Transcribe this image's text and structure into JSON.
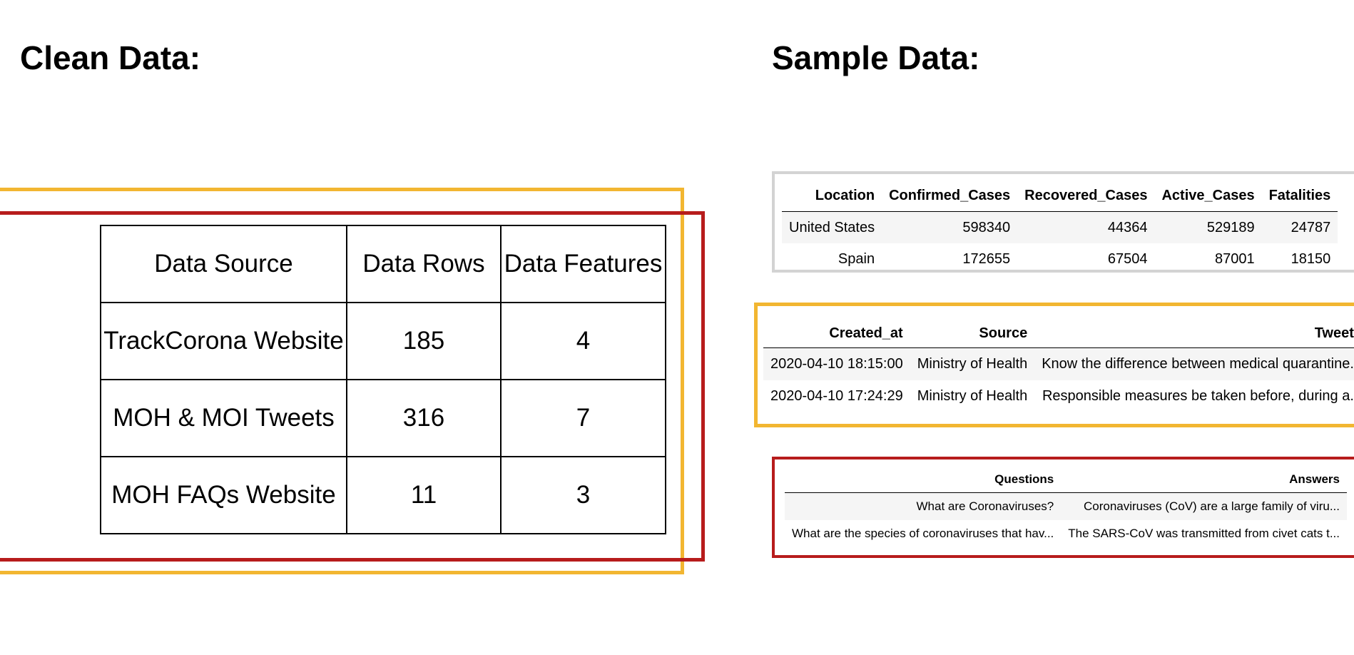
{
  "clean": {
    "title": "Clean Data:",
    "table": {
      "headers": [
        "Data Source",
        "Data Rows",
        "Data Features"
      ],
      "rows": [
        [
          "TrackCorona Website",
          "185",
          "4"
        ],
        [
          "MOH & MOI Tweets",
          "316",
          "7"
        ],
        [
          "MOH FAQs Website",
          "11",
          "3"
        ]
      ]
    }
  },
  "sample": {
    "title": "Sample Data:",
    "cases": {
      "headers": [
        "Location",
        "Confirmed_Cases",
        "Recovered_Cases",
        "Active_Cases",
        "Fatalities"
      ],
      "rows": [
        [
          "United States",
          "598340",
          "44364",
          "529189",
          "24787"
        ],
        [
          "Spain",
          "172655",
          "67504",
          "87001",
          "18150"
        ]
      ]
    },
    "tweets": {
      "headers": [
        "Created_at",
        "Source",
        "Tweets"
      ],
      "rows": [
        [
          "2020-04-10 18:15:00",
          "Ministry of Health",
          "Know the difference between medical quarantine..."
        ],
        [
          "2020-04-10 17:24:29",
          "Ministry of Health",
          "Responsible measures be taken before, during a..."
        ]
      ]
    },
    "faqs": {
      "headers": [
        "Questions",
        "Answers"
      ],
      "rows": [
        [
          "What are Coronaviruses?",
          "Coronaviruses (CoV) are a large family of viru..."
        ],
        [
          "What are the species of coronaviruses that hav...",
          "The SARS-CoV was transmitted from civet cats t..."
        ]
      ]
    }
  },
  "colors": {
    "yellow_frame": "#f2b631",
    "red_frame": "#b71c1c",
    "gray_frame": "#d3d3d3"
  }
}
